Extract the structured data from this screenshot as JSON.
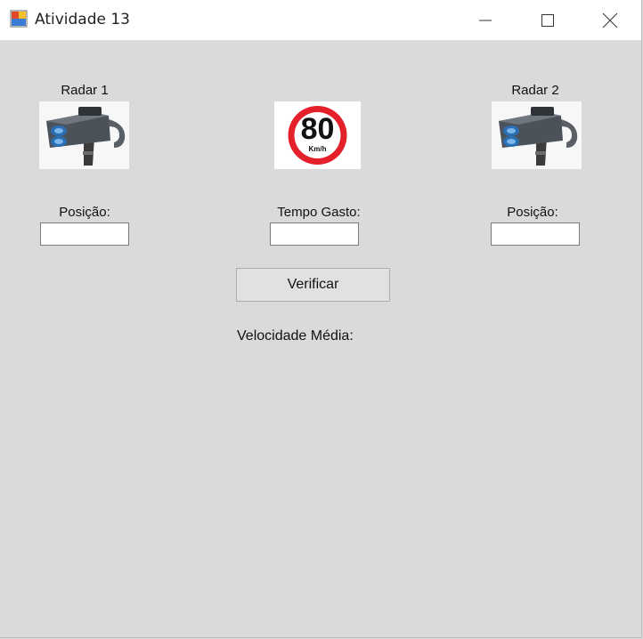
{
  "window": {
    "title": "Atividade 13",
    "background": "#dadada"
  },
  "radar1": {
    "label": "Radar 1",
    "image_icon": "radar-camera-icon"
  },
  "radar2": {
    "label": "Radar 2",
    "image_icon": "radar-camera-icon"
  },
  "speed_sign": {
    "number": "80",
    "unit": "Km/h",
    "ring_color": "#e4202a"
  },
  "fields": {
    "posicao1_label": "Posição:",
    "posicao1_value": "",
    "tempo_label": "Tempo Gasto:",
    "tempo_value": "",
    "posicao2_label": "Posição:",
    "posicao2_value": ""
  },
  "verify_button_label": "Verificar",
  "result_label": "Velocidade Média:"
}
